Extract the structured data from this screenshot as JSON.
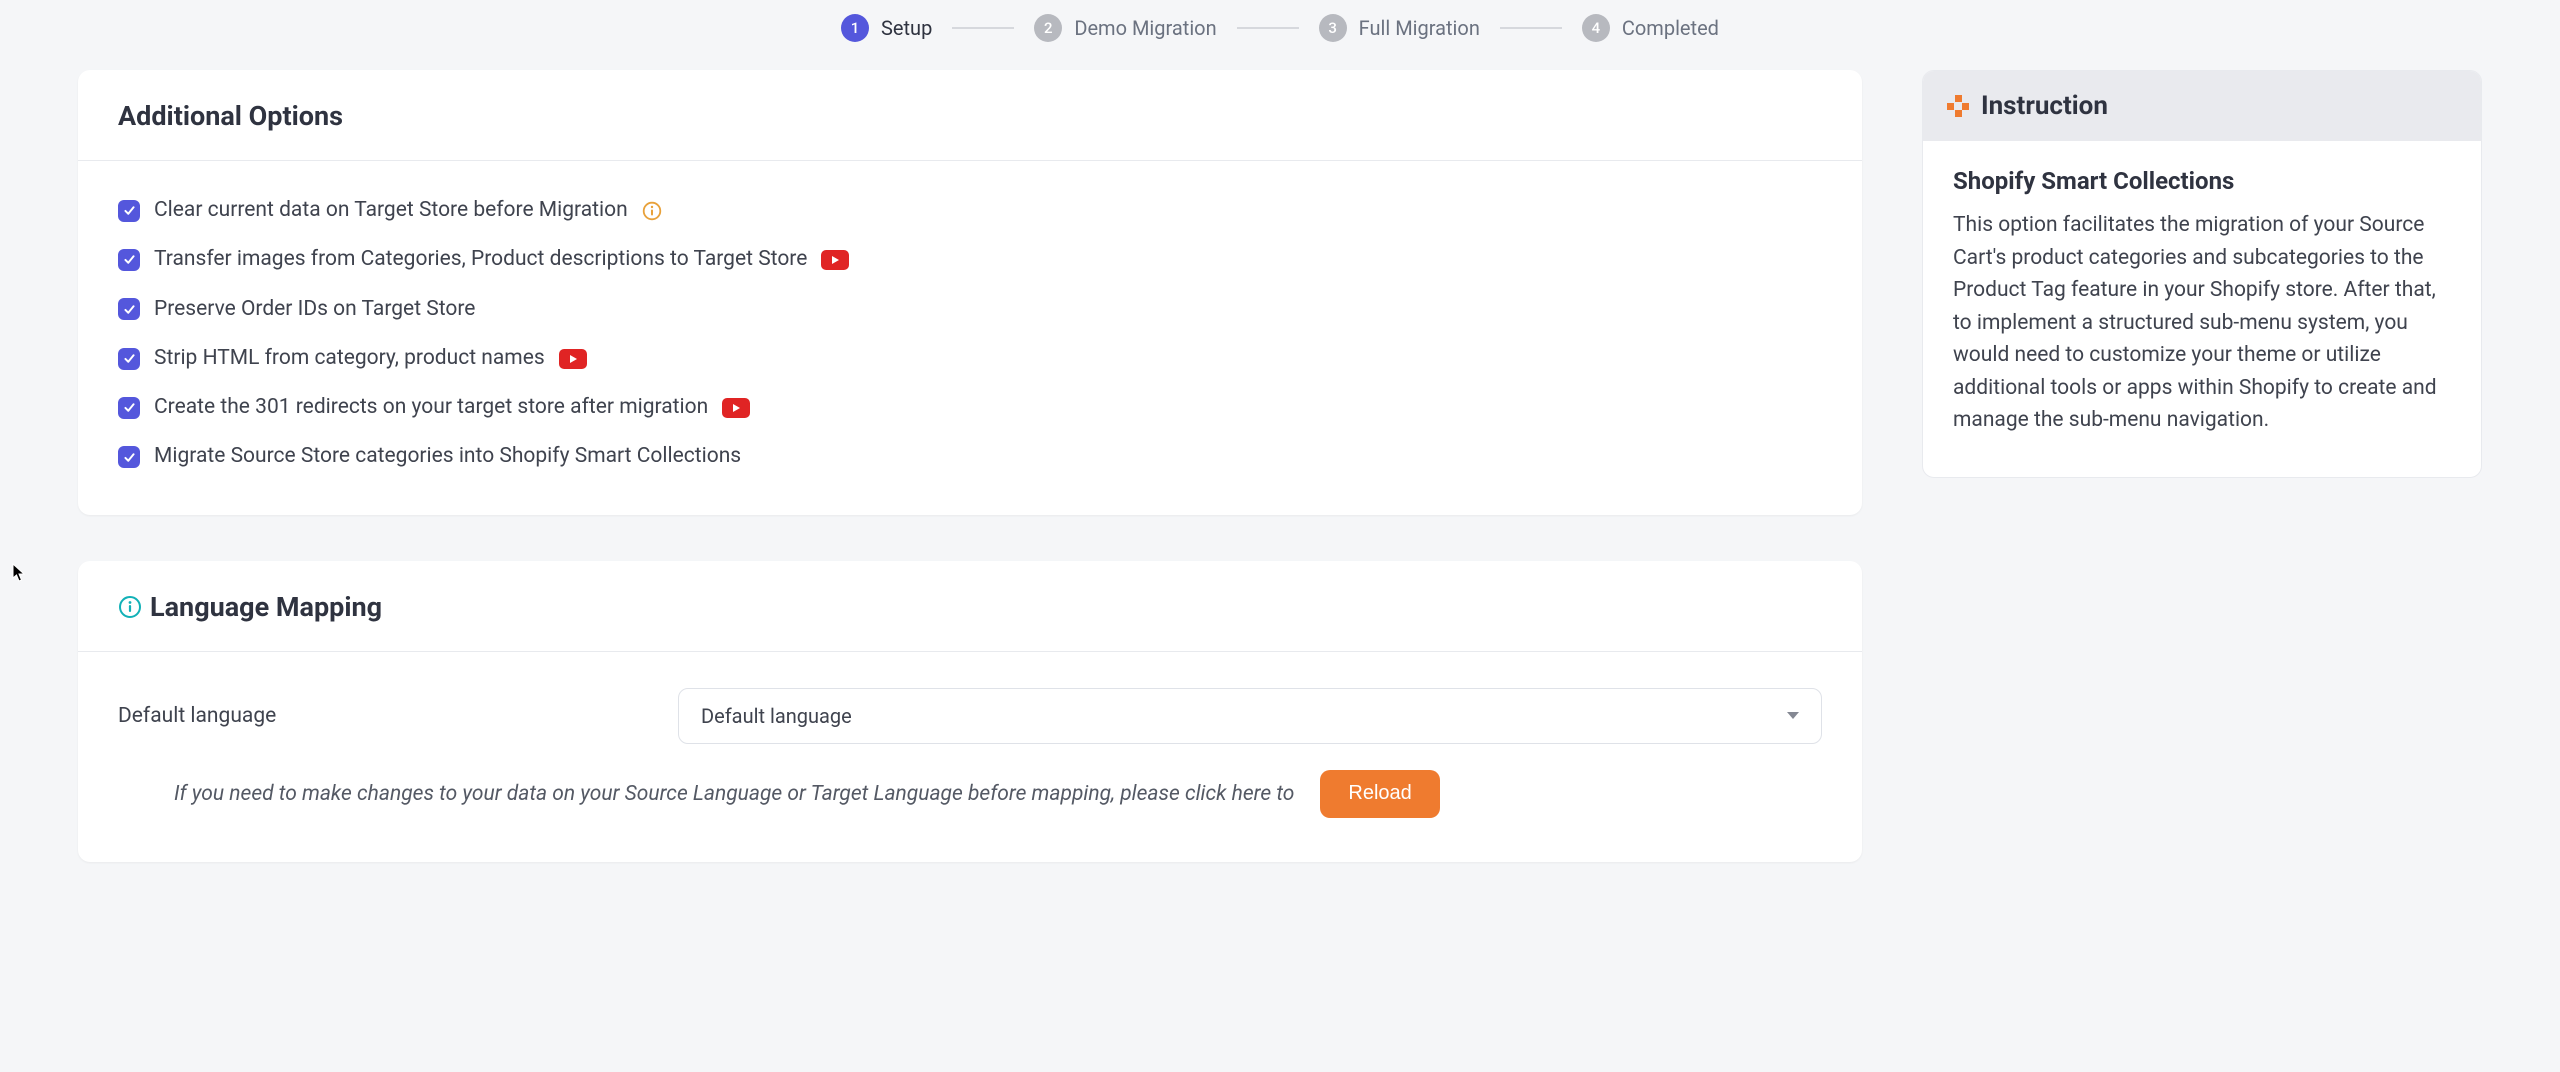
{
  "stepper": {
    "steps": [
      {
        "num": "1",
        "label": "Setup",
        "active": true
      },
      {
        "num": "2",
        "label": "Demo Migration",
        "active": false
      },
      {
        "num": "3",
        "label": "Full Migration",
        "active": false
      },
      {
        "num": "4",
        "label": "Completed",
        "active": false
      }
    ]
  },
  "options_card": {
    "title": "Additional Options",
    "items": [
      {
        "label": "Clear current data on Target Store before Migration",
        "checked": true,
        "info": true,
        "video": false
      },
      {
        "label": "Transfer images from Categories, Product descriptions to Target Store",
        "checked": true,
        "info": false,
        "video": true
      },
      {
        "label": "Preserve Order IDs on Target Store",
        "checked": true,
        "info": false,
        "video": false
      },
      {
        "label": "Strip HTML from category, product names",
        "checked": true,
        "info": false,
        "video": true
      },
      {
        "label": "Create the 301 redirects on your target store after migration",
        "checked": true,
        "info": false,
        "video": true
      },
      {
        "label": "Migrate Source Store categories into Shopify Smart Collections",
        "checked": true,
        "info": false,
        "video": false
      }
    ]
  },
  "language_card": {
    "title": "Language Mapping",
    "default_label": "Default language",
    "select_value": "Default language",
    "reload_hint": "If you need to make changes to your data on your Source Language or Target Language before mapping, please click here to",
    "reload_btn": "Reload"
  },
  "instruction": {
    "header": "Instruction",
    "heading": "Shopify Smart Collections",
    "body": "This option facilitates the migration of your Source Cart's product categories and subcategories to the Product Tag feature in your Shopify store. After that, to implement a structured sub-menu system, you would need to customize your theme or utilize additional tools or apps within Shopify to create and manage the sub-menu navigation."
  }
}
